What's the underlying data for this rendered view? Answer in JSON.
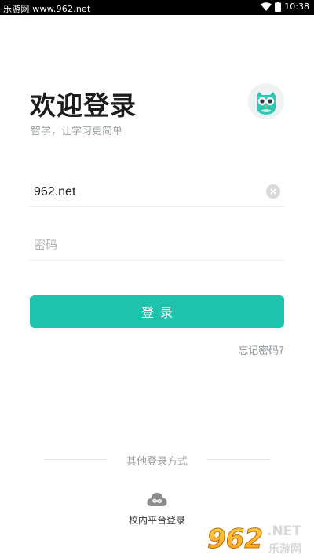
{
  "status_bar": {
    "source_text": "乐游网 www.962.net",
    "time": "10:38",
    "icons": [
      "wifi-icon",
      "battery-icon"
    ]
  },
  "header": {
    "title": "欢迎登录",
    "subtitle": "智学，让学习更简单",
    "avatar_icon": "owl-icon"
  },
  "form": {
    "username_value": "962.net",
    "password_placeholder": "密码",
    "login_label": "登录",
    "forgot_label": "忘记密码?"
  },
  "other_login": {
    "divider_label": "其他登录方式",
    "campus_label": "校内平台登录",
    "campus_icon": "cloud-link-icon"
  },
  "watermark": {
    "brand": "962.NET",
    "sub": "乐游网"
  },
  "colors": {
    "accent": "#1dc3ad",
    "owl": "#2ec7b4",
    "text_secondary": "#9aa0a3"
  }
}
